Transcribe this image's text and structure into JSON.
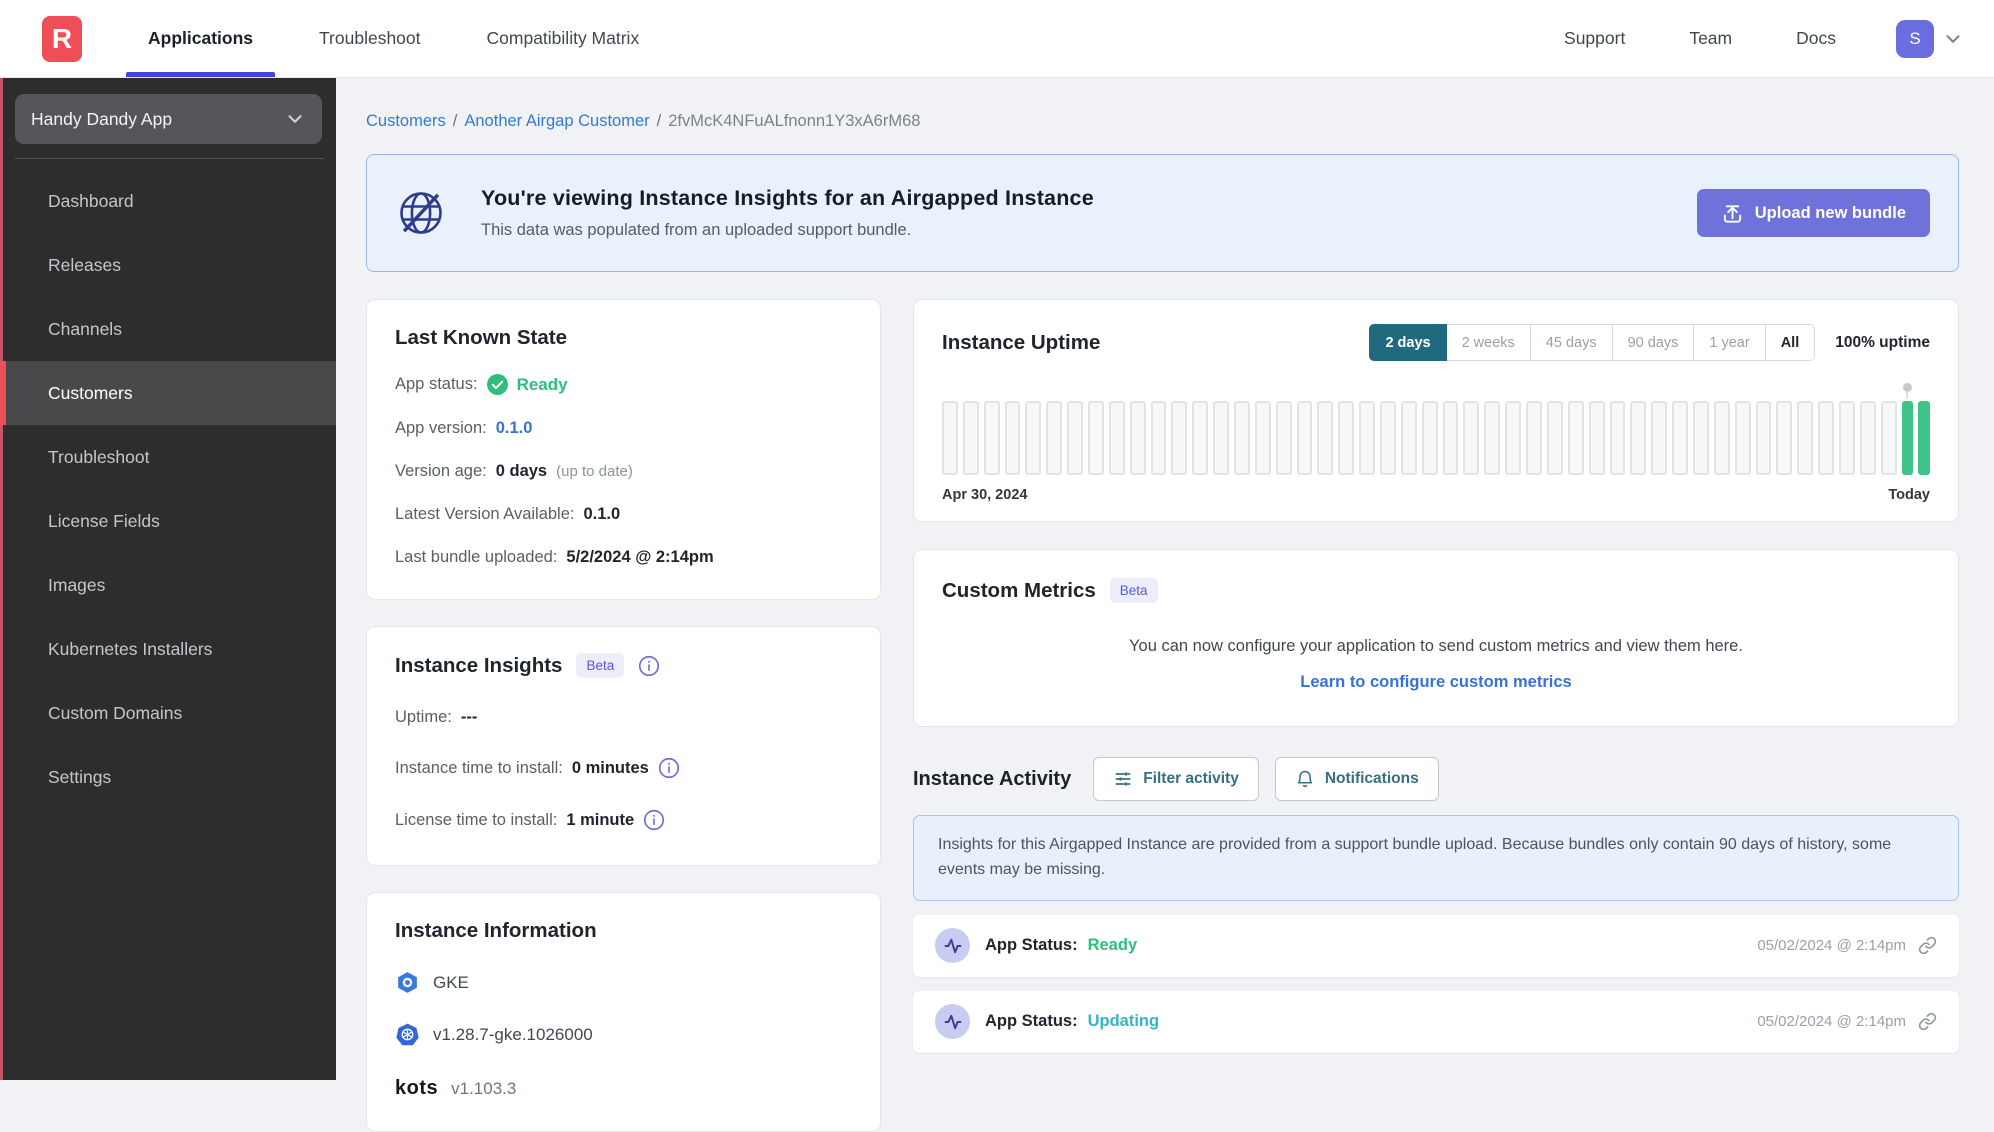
{
  "header": {
    "logo_letter": "R",
    "nav": [
      {
        "label": "Applications"
      },
      {
        "label": "Troubleshoot"
      },
      {
        "label": "Compatibility Matrix"
      }
    ],
    "right_nav": [
      {
        "label": "Support"
      },
      {
        "label": "Team"
      },
      {
        "label": "Docs"
      }
    ],
    "avatar_initial": "S"
  },
  "sidebar": {
    "app_selector": "Handy Dandy App",
    "items": [
      {
        "label": "Dashboard"
      },
      {
        "label": "Releases"
      },
      {
        "label": "Channels"
      },
      {
        "label": "Customers"
      },
      {
        "label": "Troubleshoot"
      },
      {
        "label": "License Fields"
      },
      {
        "label": "Images"
      },
      {
        "label": "Kubernetes Installers"
      },
      {
        "label": "Custom Domains"
      },
      {
        "label": "Settings"
      }
    ]
  },
  "breadcrumb": {
    "link1": "Customers",
    "link2": "Another Airgap Customer",
    "sep": "/",
    "current": "2fvMcK4NFuALfnonn1Y3xA6rM68"
  },
  "banner": {
    "title": "You're viewing Instance Insights for an Airgapped Instance",
    "subtitle": "This data was populated from an uploaded support bundle.",
    "button_label": "Upload new bundle"
  },
  "last_known_state": {
    "title": "Last Known State",
    "rows": [
      {
        "label": "App status:",
        "value": "Ready"
      },
      {
        "label": "App version:",
        "value": "0.1.0"
      },
      {
        "label": "Version age:",
        "value": "0 days",
        "suffix": "(up to date)"
      },
      {
        "label": "Latest Version Available:",
        "value": "0.1.0"
      },
      {
        "label": "Last bundle uploaded:",
        "value": "5/2/2024 @ 2:14pm"
      }
    ]
  },
  "instance_insights": {
    "title": "Instance Insights",
    "badge": "Beta",
    "rows": [
      {
        "label": "Uptime:",
        "value": "---"
      },
      {
        "label": "Instance time to install:",
        "value": "0 minutes"
      },
      {
        "label": "License time to install:",
        "value": "1 minute"
      }
    ]
  },
  "instance_information": {
    "title": "Instance Information",
    "distribution": "GKE",
    "k8s_version": "v1.28.7-gke.1026000",
    "kots_brand": "kots",
    "kots_version": "v1.103.3"
  },
  "uptime_card": {
    "title": "Instance Uptime",
    "ranges": [
      {
        "label": "2 days",
        "active": true
      },
      {
        "label": "2 weeks",
        "active": false
      },
      {
        "label": "45 days",
        "active": false
      },
      {
        "label": "90 days",
        "active": false
      },
      {
        "label": "1 year",
        "active": false
      },
      {
        "label": "All",
        "active": false
      }
    ],
    "uptime_label": "100% uptime",
    "start_label": "Apr 30, 2024",
    "end_label": "Today",
    "chart_data": {
      "type": "bar",
      "description": "hourly uptime cells over 2 days",
      "total_bars": 48,
      "green_bars": 2,
      "bar_color_up": "#3ec389",
      "bar_color_empty": "#f7f8f9"
    }
  },
  "custom_metrics": {
    "title": "Custom Metrics",
    "badge": "Beta",
    "body": "You can now configure your application to send custom metrics and view them here.",
    "link": "Learn to configure custom metrics"
  },
  "instance_activity": {
    "title": "Instance Activity",
    "filter_button": "Filter activity",
    "notifications_button": "Notifications",
    "notice": "Insights for this Airgapped Instance are provided from a support bundle upload. Because bundles only contain 90 days of history, some events may be missing.",
    "events": [
      {
        "label": "App Status:",
        "status": "Ready",
        "status_color": "#2fbe7e",
        "timestamp": "05/02/2024 @ 2:14pm"
      },
      {
        "label": "App Status:",
        "status": "Updating",
        "status_color": "#35b5c2",
        "timestamp": "05/02/2024 @ 2:14pm"
      }
    ]
  },
  "colors": {
    "brand_red": "#f04e56",
    "accent_indigo": "#6f72db",
    "link_blue": "#3573d6",
    "status_ready_green": "#2fbe7e",
    "status_updating_teal": "#35b5c2",
    "active_range_teal": "#20697f",
    "uptime_bar_green": "#3ec389"
  }
}
